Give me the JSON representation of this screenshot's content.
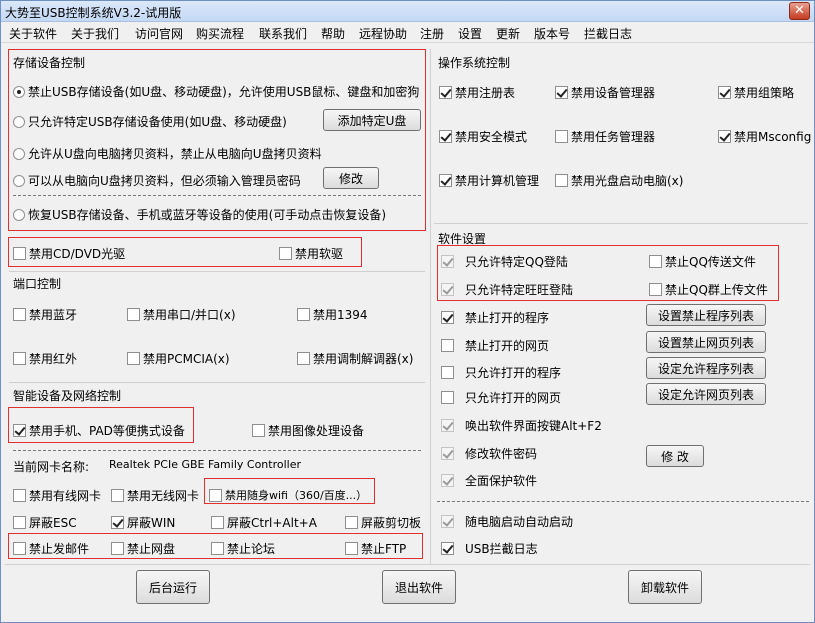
{
  "window": {
    "title": "大势至USB控制系统V3.2-试用版",
    "close": "✕"
  },
  "menu": [
    "关于软件",
    "关于我们",
    "访问官网",
    "购买流程",
    "联系我们",
    "帮助",
    "远程协助",
    "注册",
    "设置",
    "更新",
    "版本号",
    "拦截日志"
  ],
  "storage": {
    "title": "存储设备控制",
    "opt1": "禁止USB存储设备(如U盘、移动硬盘)，允许使用USB鼠标、键盘和加密狗",
    "opt2": "只允许特定USB存储设备使用(如U盘、移动硬盘)",
    "opt3": "允许从U盘向电脑拷贝资料，禁止从电脑向U盘拷贝资料",
    "opt4": "可以从电脑向U盘拷贝资料，但必须输入管理员密码",
    "opt5": "恢复USB存储设备、手机或蓝牙等设备的使用(可手动点击恢复设备)",
    "add_button": "添加特定U盘",
    "modify_button": "修改"
  },
  "drives": {
    "cd": "禁用CD/DVD光驱",
    "floppy": "禁用软驱"
  },
  "port": {
    "title": "端口控制",
    "bt": "禁用蓝牙",
    "serial": "禁用串口/并口(x)",
    "p1394": "禁用1394",
    "ir": "禁用红外",
    "pcmcia": "禁用PCMCIA(x)",
    "modem": "禁用调制解调器(x)"
  },
  "smart": {
    "title": "智能设备及网络控制",
    "mobile": "禁用手机、PAD等便携式设备",
    "imaging": "禁用图像处理设备"
  },
  "net": {
    "nic_label": "当前网卡名称:",
    "nic_value": "Realtek PCIe GBE Family Controller",
    "wired": "禁用有线网卡",
    "wireless": "禁用无线网卡",
    "wifi": "禁用随身wifi（360/百度...）",
    "esc": "屏蔽ESC",
    "win": "屏蔽WIN",
    "cad": "屏蔽Ctrl+Alt+A",
    "clip": "屏蔽剪切板",
    "mail": "禁止发邮件",
    "disk": "禁止网盘",
    "forum": "禁止论坛",
    "ftp": "禁止FTP"
  },
  "os": {
    "title": "操作系统控制",
    "reg": "禁用注册表",
    "devmgr": "禁用设备管理器",
    "gpedit": "禁用组策略",
    "safe": "禁用安全模式",
    "taskmgr": "禁用任务管理器",
    "msconfig": "禁用Msconfig",
    "compmgmt": "禁用计算机管理",
    "cdboot": "禁用光盘启动电脑(x)"
  },
  "soft": {
    "title": "软件设置",
    "qq": "只允许特定QQ登陆",
    "qqfile": "禁止QQ传送文件",
    "ww": "只允许特定旺旺登陆",
    "qqgroup": "禁止QQ群上传文件",
    "prog": "禁止打开的程序",
    "web": "禁止打开的网页",
    "allowprog": "只允许打开的程序",
    "allowweb": "只允许打开的网页",
    "btn_prog": "设置禁止程序列表",
    "btn_web": "设置禁止网页列表",
    "btn_allowprog": "设定允许程序列表",
    "btn_allowweb": "设定允许网页列表",
    "hotkey": "唤出软件界面按键Alt+F2",
    "pwd": "修改软件密码",
    "pwd_btn": "修 改",
    "protect": "全面保护软件",
    "autostart": "随电脑启动自动启动",
    "usblog": "USB拦截日志"
  },
  "footer": {
    "bg": "后台运行",
    "exit": "退出软件",
    "uninstall": "卸载软件"
  }
}
